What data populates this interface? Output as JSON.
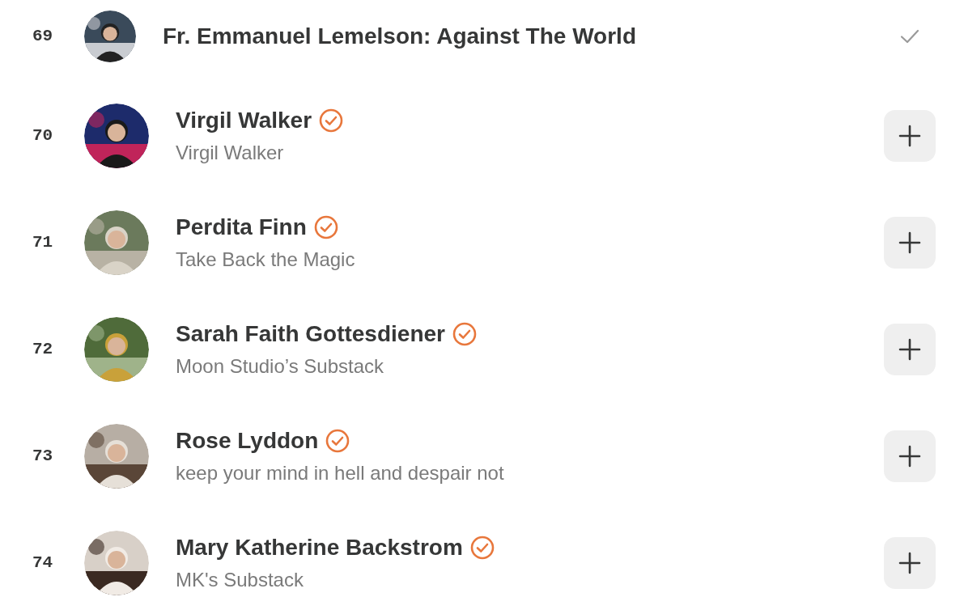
{
  "rows": [
    {
      "rank": "69",
      "kind": "compact",
      "name": "Fr. Emmanuel Lemelson: Against The World",
      "verified": false,
      "subscribed": true
    },
    {
      "rank": "70",
      "kind": "standard",
      "name": "Virgil Walker",
      "subtitle": "Virgil Walker",
      "verified": true,
      "subscribed": false
    },
    {
      "rank": "71",
      "kind": "standard",
      "name": "Perdita Finn",
      "subtitle": "Take Back the Magic",
      "verified": true,
      "subscribed": false
    },
    {
      "rank": "72",
      "kind": "standard",
      "name": "Sarah Faith Gottesdiener",
      "subtitle": "Moon Studio’s Substack",
      "verified": true,
      "subscribed": false
    },
    {
      "rank": "73",
      "kind": "standard",
      "name": "Rose Lyddon",
      "subtitle": "keep your mind in hell and despair not",
      "verified": true,
      "subscribed": false
    },
    {
      "rank": "74",
      "kind": "standard",
      "name": "Mary Katherine Backstrom",
      "subtitle": "MK's Substack",
      "verified": true,
      "subscribed": false
    }
  ]
}
